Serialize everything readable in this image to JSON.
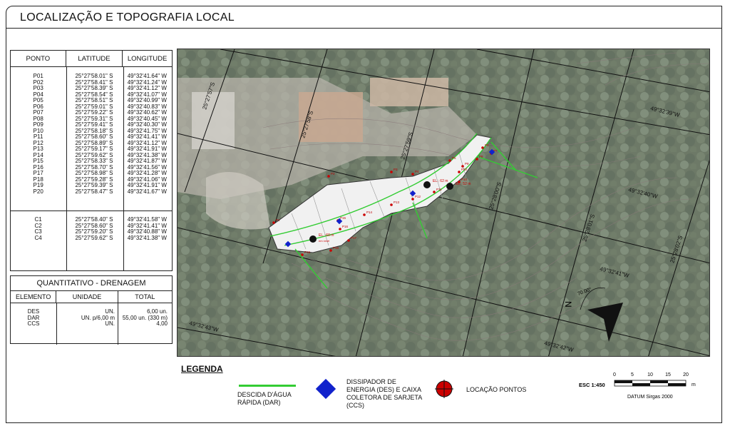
{
  "title": "LOCALIZAÇÃO E TOPOGRAFIA LOCAL",
  "coord_table": {
    "headers": [
      "PONTO",
      "LATITUDE",
      "LONGITUDE"
    ],
    "points": [
      [
        "P01",
        "25°27'58.01\" S",
        "49°32'41.64\" W"
      ],
      [
        "P02",
        "25°27'58.41\" S",
        "49°32'41.24\" W"
      ],
      [
        "P03",
        "25°27'58.39\" S",
        "49°32'41.12\" W"
      ],
      [
        "P04",
        "25°27'58.54\" S",
        "49°32'41.07\" W"
      ],
      [
        "P05",
        "25°27'58.51\" S",
        "49°32'40.99\" W"
      ],
      [
        "P06",
        "25°27'59.01\" S",
        "49°32'40.83\" W"
      ],
      [
        "P07",
        "25°27'59.22\" S",
        "49°32'40.62\" W"
      ],
      [
        "P08",
        "25°27'59.31\" S",
        "49°32'40.45\" W"
      ],
      [
        "P09",
        "25°27'59.41\" S",
        "49°32'40.30\" W"
      ],
      [
        "P10",
        "25°27'58.18\" S",
        "49°32'41.75\" W"
      ],
      [
        "P11",
        "25°27'58.60\" S",
        "49°32'41.41\" W"
      ],
      [
        "P12",
        "25°27'58.89\" S",
        "49°32'41.12\" W"
      ],
      [
        "P13",
        "25°27'59.17\" S",
        "49°32'41.91\" W"
      ],
      [
        "P14",
        "25°27'59.62\" S",
        "49°32'41.38\" W"
      ],
      [
        "P15",
        "25°27'58.33\" S",
        "49°32'41.87\" W"
      ],
      [
        "P16",
        "25°27'58.70\" S",
        "49°32'41.56\" W"
      ],
      [
        "P17",
        "25°27'58.98\" S",
        "49°32'41.28\" W"
      ],
      [
        "P18",
        "25°27'59.28\" S",
        "49°32'41.06\" W"
      ],
      [
        "P19",
        "25°27'59.39\" S",
        "49°32'41.91\" W"
      ],
      [
        "P20",
        "25°27'58.47\" S",
        "49°32'41.67\" W"
      ]
    ],
    "collectors": [
      [
        "C1",
        "25°27'58.40\" S",
        "49°32'41.58\" W"
      ],
      [
        "C2",
        "25°27'58.60\" S",
        "49°32'41.41\" W"
      ],
      [
        "C3",
        "25°27'59.20\" S",
        "49°32'40.88\" W"
      ],
      [
        "C4",
        "25°27'59.62\" S",
        "49°32'41.38\" W"
      ]
    ]
  },
  "quantitativo": {
    "title": "QUANTITATIVO - DRENAGEM",
    "headers": [
      "ELEMENTO",
      "UNIDADE",
      "TOTAL"
    ],
    "rows": [
      [
        "DES",
        "UN.",
        "6,00 un."
      ],
      [
        "DAR",
        "UN. p/6,00 m",
        "55,00 un. (330 m)"
      ],
      [
        "CCS",
        "UN.",
        "4,00"
      ]
    ]
  },
  "map": {
    "grid_labels": [
      "25°27'57\"S",
      "25°27'58\"S",
      "25°27'59\"S",
      "25°28'00\"S",
      "25°28'01\"S",
      "25°28'02\"S",
      "49°32'39\"W",
      "49°32'40\"W",
      "49°32'41\"W",
      "49°32'42\"W",
      "49°32'43\"W"
    ],
    "point_labels": [
      "P1",
      "P2",
      "P3",
      "P4",
      "P5",
      "P6",
      "P7",
      "P8",
      "P9",
      "P10",
      "P11",
      "P12",
      "P13",
      "P14",
      "P15",
      "P16",
      "P17",
      "P18",
      "P19",
      "P20"
    ],
    "collector_labels": [
      "C1",
      "C2",
      "C3",
      "C4"
    ],
    "elevation_labels": [
      "EL.: 60 m",
      "EL.: 62 m",
      "EL.: 52 m"
    ],
    "elevation_sub": "em nível",
    "north": {
      "label": "N",
      "angle": "70.00°"
    }
  },
  "legend": {
    "title": "LEGENDA",
    "dar": "DESCIDA D'ÁGUA RÁPIDA (DAR)",
    "des": "DISSIPADOR DE ENERGIA (DES) E CAIXA COLETORA DE SARJETA (CCS)",
    "loc": "LOCAÇÃO PONTOS",
    "colors": {
      "dar": "#33cc33",
      "des": "#1122cc",
      "loc": "#cc0000"
    }
  },
  "scale": {
    "label": "ESC 1:450",
    "ticks": [
      "0",
      "5",
      "10",
      "15",
      "20"
    ],
    "unit": "m",
    "datum": "DATUM Sirgas 2000"
  }
}
